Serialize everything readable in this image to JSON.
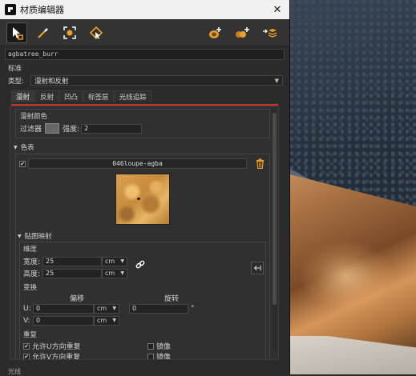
{
  "window": {
    "title": "材质编辑器",
    "close_glyph": "✕"
  },
  "toolbar": {
    "tools_left": [
      "select-arrow-icon",
      "eyedropper-icon",
      "fit-frame-icon",
      "pick-material-icon"
    ],
    "tools_right": [
      "add-material-icon",
      "add-multi-material-icon",
      "import-layers-icon"
    ]
  },
  "material_name": "agbatree_burr",
  "section_standard": "标准",
  "type": {
    "label": "类型:",
    "value": "漫射和反射"
  },
  "tabs": [
    "漫射",
    "反射",
    "凹凸",
    "标签层",
    "光线追踪"
  ],
  "active_tab": 0,
  "diffuse": {
    "group_title": "漫射颜色",
    "filter_label": "过滤器",
    "strength_label": "强度:",
    "strength_value": "2",
    "swatch_color": "#6a6566"
  },
  "color_section": {
    "fold_label": "色表",
    "texture_name": "046loupe-agba",
    "delete_icon": "trash-icon"
  },
  "mapping": {
    "fold_label": "贴图映射",
    "size_title": "维度",
    "width_label": "宽度:",
    "width_value": "25",
    "height_label": "高度:",
    "height_value": "25",
    "unit": "cm",
    "transform_title": "变换",
    "offset_label": "偏移",
    "rotate_label": "旋转",
    "u_label": "U:",
    "u_value": "0",
    "v_label": "V:",
    "v_value": "0",
    "rotate_value": "0",
    "rotate_unit": "°",
    "repeat_title": "重复",
    "repeat_u": "允许U方向重复",
    "repeat_v": "允许V方向重复",
    "mirror_label": "镜像"
  },
  "bottom_cut_label": "光线"
}
